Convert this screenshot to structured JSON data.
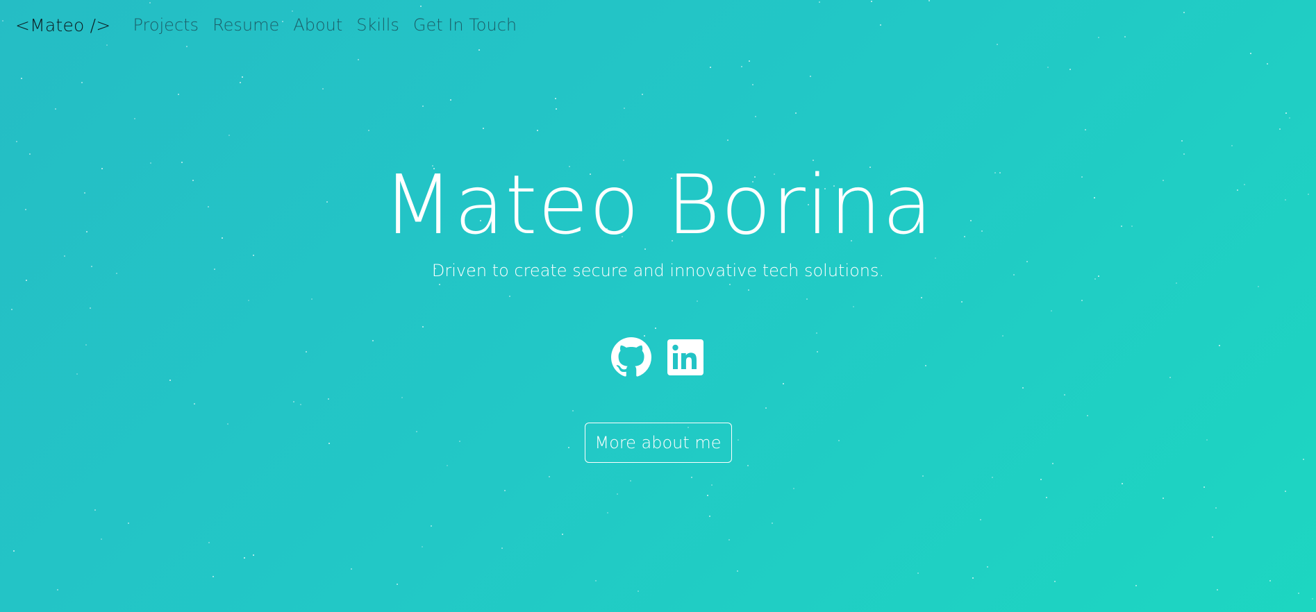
{
  "nav": {
    "brand": "<Mateo />",
    "links": [
      {
        "label": "Projects"
      },
      {
        "label": "Resume"
      },
      {
        "label": "About"
      },
      {
        "label": "Skills"
      },
      {
        "label": "Get In Touch"
      }
    ]
  },
  "hero": {
    "title": "Mateo Borina",
    "subtitle": "Driven to create secure and innovative tech solutions.",
    "socials": [
      {
        "icon": "github-icon"
      },
      {
        "icon": "linkedin-icon"
      }
    ],
    "cta_label": "More about me"
  },
  "colors": {
    "background_start": "#25bdc5",
    "background_end": "#1dd6c1",
    "nav_link": "#1b5e68",
    "brand": "#0c1a1f",
    "hero_text": "#ffffff"
  }
}
